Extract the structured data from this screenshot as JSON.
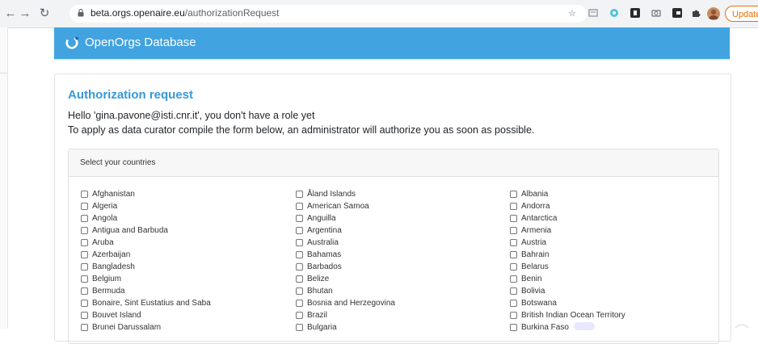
{
  "browser": {
    "url_host": "beta.orgs.openaire.eu",
    "url_path": "/authorizationRequest",
    "update_label": "Update"
  },
  "app": {
    "title": "OpenOrgs Database"
  },
  "card": {
    "title": "Authorization request",
    "line1": "Hello 'gina.pavone@isti.cnr.it', you don't have a role yet",
    "line2": "To apply as data curator compile the form below, an administrator will authorize you as soon as possible."
  },
  "countries": {
    "header": "Select your countries",
    "col1": [
      "Afghanistan",
      "Algeria",
      "Angola",
      "Antigua and Barbuda",
      "Aruba",
      "Azerbaijan",
      "Bangladesh",
      "Belgium",
      "Bermuda",
      "Bonaire, Sint Eustatius and Saba",
      "Bouvet Island",
      "Brunei Darussalam"
    ],
    "col2": [
      "Åland Islands",
      "American Samoa",
      "Anguilla",
      "Argentina",
      "Australia",
      "Bahamas",
      "Barbados",
      "Belize",
      "Bhutan",
      "Bosnia and Herzegovina",
      "Brazil",
      "Bulgaria"
    ],
    "col3": [
      "Albania",
      "Andorra",
      "Antarctica",
      "Armenia",
      "Austria",
      "Bahrain",
      "Belarus",
      "Benin",
      "Bolivia",
      "Botswana",
      "British Indian Ocean Territory",
      "Burkina Faso"
    ]
  },
  "colors": {
    "header_bg": "#41a3e0",
    "title_blue": "#3598db",
    "update_orange": "#e8710a"
  }
}
